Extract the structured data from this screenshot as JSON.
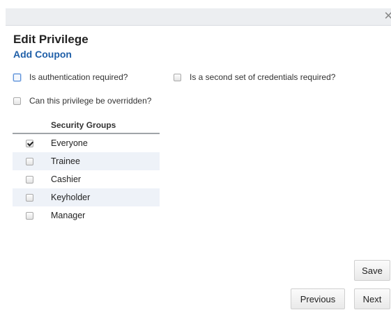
{
  "dialog": {
    "close_glyph": "✕",
    "title": "Edit Privilege",
    "subtitle": "Add Coupon"
  },
  "options": {
    "auth_required": {
      "label": "Is authentication required?",
      "checked": false
    },
    "second_credentials": {
      "label": "Is a second set of credentials required?",
      "checked": false
    },
    "can_override": {
      "label": "Can this privilege be overridden?",
      "checked": false
    }
  },
  "security_groups": {
    "header": "Security Groups",
    "rows": [
      {
        "label": "Everyone",
        "checked": true
      },
      {
        "label": "Trainee",
        "checked": false
      },
      {
        "label": "Cashier",
        "checked": false
      },
      {
        "label": "Keyholder",
        "checked": false
      },
      {
        "label": "Manager",
        "checked": false
      }
    ]
  },
  "buttons": {
    "save": "Save",
    "previous": "Previous",
    "next": "Next"
  },
  "colors": {
    "accent": "#1f5fa8",
    "row_alt": "#eef2f8",
    "titlebar": "#eceef1"
  }
}
